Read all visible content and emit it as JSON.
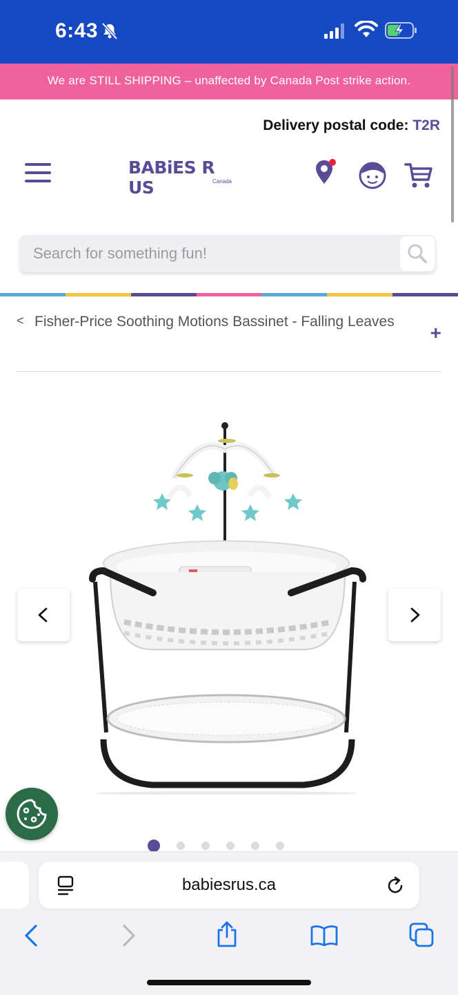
{
  "status_bar": {
    "time": "6:43",
    "colors": {
      "background": "#1648c2"
    }
  },
  "promo": {
    "text": "We are STILL SHIPPING – unaffected by Canada Post strike action.",
    "background": "#f0629c"
  },
  "delivery": {
    "label": "Delivery postal code:",
    "code": "T2R"
  },
  "header": {
    "logo_text": "BABiES R US",
    "logo_sub": "Canada",
    "icons": [
      "menu-icon",
      "store-locator-icon",
      "account-icon",
      "cart-icon"
    ],
    "brand_color": "#5b4b97"
  },
  "search": {
    "placeholder": "Search for something fun!"
  },
  "rainbow_colors": [
    "#5aa9e0",
    "#f6c243",
    "#5b4b97",
    "#f0629c",
    "#5aa9e0",
    "#f6c243",
    "#5b4b97"
  ],
  "breadcrumb": {
    "back": "<",
    "title": "Fisher-Price Soothing Motions Bassinet - Falling Leaves",
    "expand": "+"
  },
  "gallery": {
    "image_count": 6,
    "active_index": 0,
    "image_alt": "Fisher-Price Soothing Motions Bassinet with mobile"
  },
  "safari": {
    "url": "babiesrus.ca",
    "toolbar_icons": [
      "back-icon",
      "forward-icon",
      "share-icon",
      "bookmarks-icon",
      "tabs-icon"
    ]
  }
}
